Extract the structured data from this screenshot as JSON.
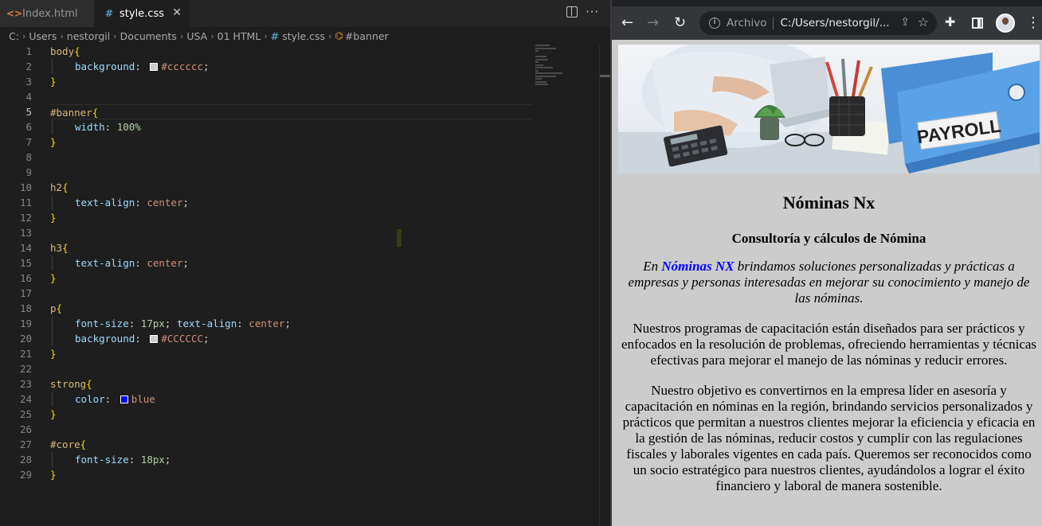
{
  "editor": {
    "tabs": [
      {
        "icon": "html-file-icon",
        "label": "Index.html"
      },
      {
        "icon": "css-file-icon",
        "label": "style.css",
        "close": "✕"
      }
    ],
    "breadcrumb": [
      "C:",
      "Users",
      "nestorgil",
      "Documents",
      "USA",
      "01 HTML",
      "style.css",
      "#banner"
    ],
    "line_numbers": [
      "1",
      "2",
      "3",
      "4",
      "5",
      "6",
      "7",
      "8",
      "9",
      "10",
      "11",
      "12",
      "13",
      "14",
      "15",
      "16",
      "17",
      "18",
      "19",
      "20",
      "21",
      "22",
      "23",
      "24",
      "25",
      "26",
      "27",
      "28",
      "29"
    ],
    "active_line": "5",
    "code": {
      "l1_sel": "body",
      "l2_prop": "background",
      "l2_val": "#cccccc",
      "l5_sel": "#banner",
      "l6_prop": "width",
      "l6_val": "100%",
      "l10_sel": "h2",
      "l11_prop": "text-align",
      "l11_val": "center",
      "l14_sel": "h3",
      "l15_prop": "text-align",
      "l15_val": "center",
      "l18_sel": "p",
      "l19_prop1": "font-size",
      "l19_val1": "17px",
      "l19_prop2": "text-align",
      "l19_val2": "center",
      "l20_prop": "background",
      "l20_val": "#CCCCCC",
      "l23_sel": "strong",
      "l24_prop": "color",
      "l24_val": "blue",
      "l27_sel": "#core",
      "l28_prop": "font-size",
      "l28_val": "18px"
    },
    "swatch_colors": {
      "gray": "#cccccc",
      "blue": "#0000ff"
    }
  },
  "browser": {
    "scheme_label": "Archivo",
    "url": "C:/Users/nestorgil/...",
    "page": {
      "banner_label": "PAYROLL",
      "title": "Nóminas Nx",
      "subtitle": "Consultoría y cálculos de Nómina",
      "intro_before": "En ",
      "intro_strong": "Nóminas NX",
      "intro_after": " brindamos soluciones personalizadas y prácticas a empresas y personas interesadas en mejorar su conocimiento y manejo de las nóminas.",
      "paragraph2": "Nuestros programas de capacitación están diseñados para ser prácticos y enfocados en la resolución de problemas, ofreciendo herramientas y técnicas efectivas para mejorar el manejo de las nóminas y reducir errores.",
      "paragraph3": "Nuestro objetivo es convertirnos en la empresa líder en asesoría y capacitación en nóminas en la región, brindando servicios personalizados y prácticos que permitan a nuestros clientes mejorar la eficiencia y eficacia en la gestión de las nóminas, reducir costos y cumplir con las regulaciones fiscales y laborales vigentes en cada país. Queremos ser reconocidos como un socio estratégico para nuestros clientes, ayudándolos a lograr el éxito financiero y laboral de manera sostenible."
    }
  }
}
